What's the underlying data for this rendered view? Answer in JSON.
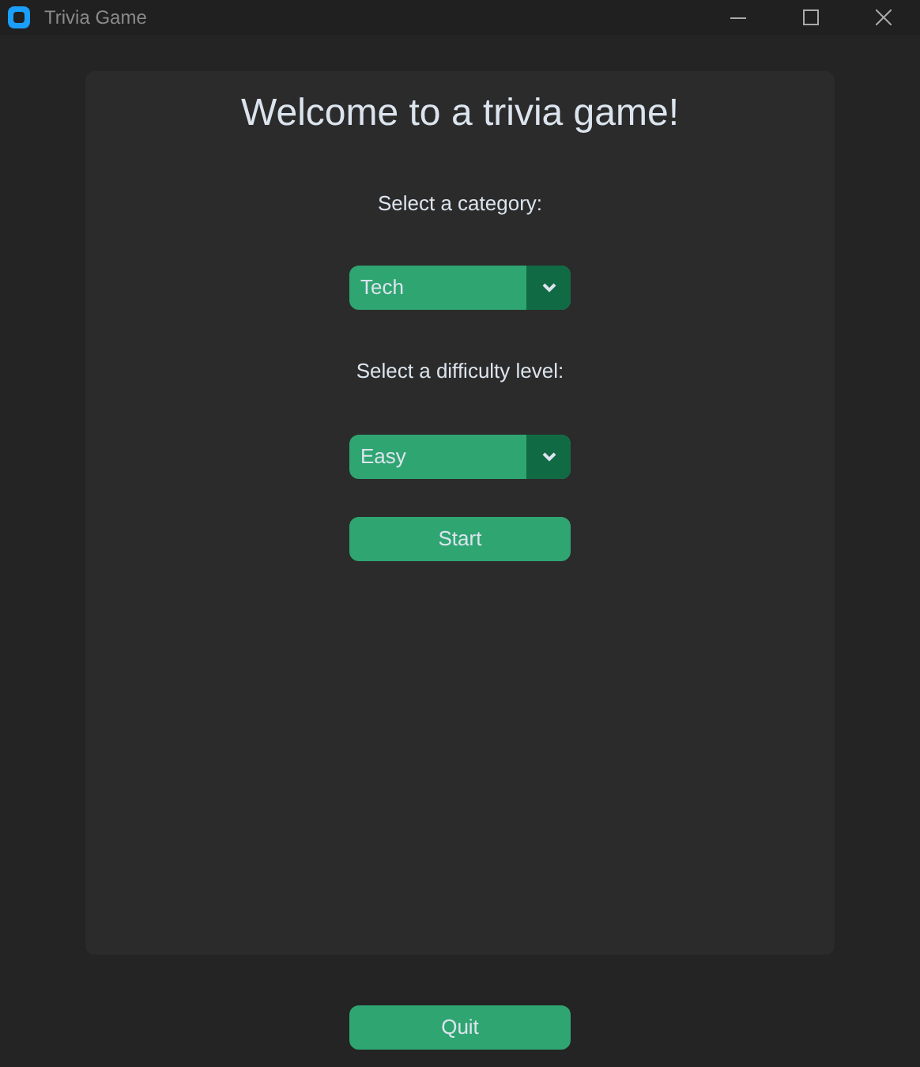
{
  "window": {
    "title": "Trivia Game"
  },
  "heading": "Welcome to a trivia game!",
  "selects": [
    {
      "label": "Select a category:",
      "value": "Tech"
    },
    {
      "label": "Select a difficulty level:",
      "value": "Easy"
    }
  ],
  "start_button": "Start",
  "quit_button": "Quit"
}
